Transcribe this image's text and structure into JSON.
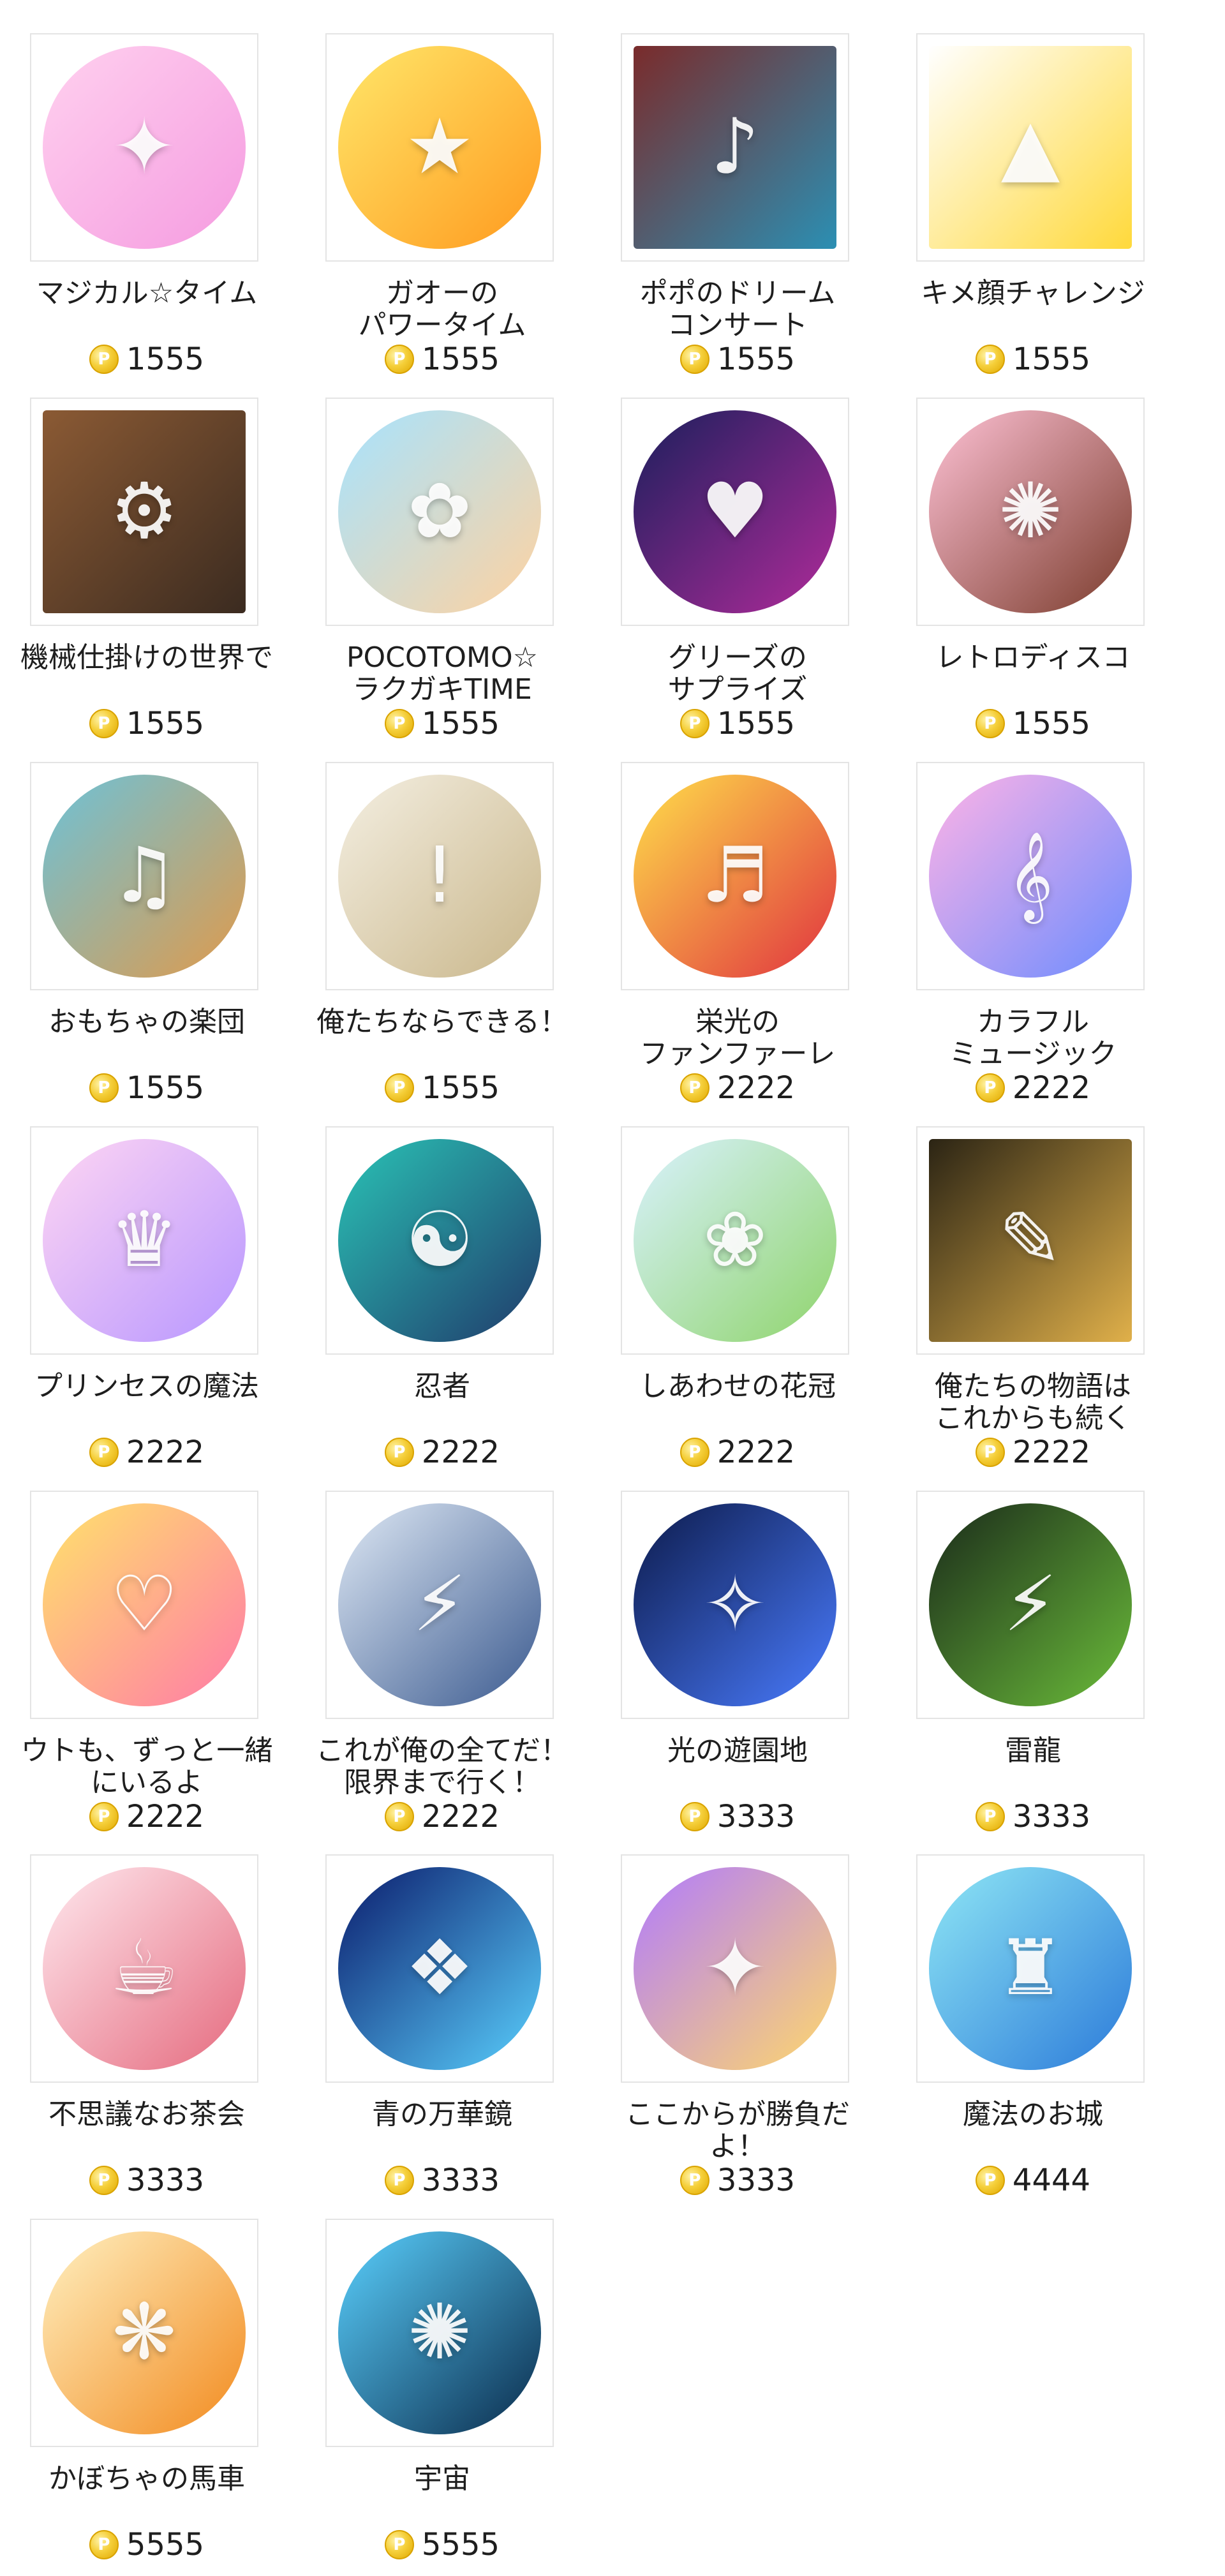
{
  "currency_symbol": "P",
  "stamps": [
    {
      "name": "マジカル☆タイム",
      "price": "1555",
      "glyph": "✦",
      "colors": [
        "#ffd1ef",
        "#f59be0"
      ],
      "icon": "magic-girl-icon"
    },
    {
      "name": "ガオーの\nパワータイム",
      "price": "1555",
      "glyph": "★",
      "colors": [
        "#ffe76a",
        "#ff9a1e"
      ],
      "icon": "hero-bear-icon"
    },
    {
      "name": "ポポのドリーム\nコンサート",
      "price": "1555",
      "glyph": "♪",
      "colors": [
        "#7a2b2b",
        "#2b8fb3"
      ],
      "icon": "concert-icon"
    },
    {
      "name": "キメ顔チャレンジ",
      "price": "1555",
      "glyph": "▲",
      "colors": [
        "#ffffff",
        "#ffd93b"
      ],
      "icon": "ready-go-icon"
    },
    {
      "name": "機械仕掛けの世界で",
      "price": "1555",
      "glyph": "⚙",
      "colors": [
        "#8b5a34",
        "#3b2b20"
      ],
      "icon": "gears-icon"
    },
    {
      "name": "POCOTOMO☆\nラクガキTIME",
      "price": "1555",
      "glyph": "✿",
      "colors": [
        "#a7e3ff",
        "#ffd2a0"
      ],
      "icon": "doodle-train-icon"
    },
    {
      "name": "グリーズの\nサプライズ",
      "price": "1555",
      "glyph": "♥",
      "colors": [
        "#1b1f5c",
        "#b02b9a"
      ],
      "icon": "bear-heart-icon"
    },
    {
      "name": "レトロディスコ",
      "price": "1555",
      "glyph": "✺",
      "colors": [
        "#ffc2d6",
        "#7a3b2b"
      ],
      "icon": "disco-afro-icon"
    },
    {
      "name": "おもちゃの楽団",
      "price": "1555",
      "glyph": "♫",
      "colors": [
        "#6cc2d9",
        "#e09a4b"
      ],
      "icon": "toy-band-icon"
    },
    {
      "name": "俺たちならできる！",
      "price": "1555",
      "glyph": "!",
      "colors": [
        "#f4efe2",
        "#c9b68a"
      ],
      "icon": "we-can-do-it-icon"
    },
    {
      "name": "栄光の\nファンファーレ",
      "price": "2222",
      "glyph": "♬",
      "colors": [
        "#ffe04a",
        "#e0323f"
      ],
      "icon": "trumpet-icon"
    },
    {
      "name": "カラフル\nミュージック",
      "price": "2222",
      "glyph": "𝄞",
      "colors": [
        "#ffb3e6",
        "#6b8cff"
      ],
      "icon": "treble-clef-icon"
    },
    {
      "name": "プリンセスの魔法",
      "price": "2222",
      "glyph": "♛",
      "colors": [
        "#ffd6f3",
        "#b796ff"
      ],
      "icon": "princess-icon"
    },
    {
      "name": "忍者",
      "price": "2222",
      "glyph": "☯",
      "colors": [
        "#2ac4b6",
        "#203a6b"
      ],
      "icon": "ninja-icon"
    },
    {
      "name": "しあわせの花冠",
      "price": "2222",
      "glyph": "❀",
      "colors": [
        "#d9f2ff",
        "#8fd46b"
      ],
      "icon": "flower-crown-icon"
    },
    {
      "name": "俺たちの物語は\nこれからも続く",
      "price": "2222",
      "glyph": "✎",
      "colors": [
        "#2b2414",
        "#e0b04a"
      ],
      "icon": "to-be-continued-icon"
    },
    {
      "name": "ウトも、ずっと一緒\nにいるよ",
      "price": "2222",
      "glyph": "♡",
      "colors": [
        "#ffe36b",
        "#ff7aa8"
      ],
      "icon": "together-icon"
    },
    {
      "name": "これが俺の全てだ！\n限界まで行く！",
      "price": "2222",
      "glyph": "⚡",
      "colors": [
        "#dfe9f5",
        "#3b5a8f"
      ],
      "icon": "limit-break-icon"
    },
    {
      "name": "光の遊園地",
      "price": "3333",
      "glyph": "✧",
      "colors": [
        "#0c1a4a",
        "#4a7cff"
      ],
      "icon": "amusement-park-icon"
    },
    {
      "name": "雷龍",
      "price": "3333",
      "glyph": "⚡",
      "colors": [
        "#1a2a1a",
        "#6bbd3a"
      ],
      "icon": "thunder-dragon-icon"
    },
    {
      "name": "不思議なお茶会",
      "price": "3333",
      "glyph": "☕",
      "colors": [
        "#ffe9ef",
        "#e56a7e"
      ],
      "icon": "tea-party-icon"
    },
    {
      "name": "青の万華鏡",
      "price": "3333",
      "glyph": "❖",
      "colors": [
        "#0a1a6b",
        "#5ad1ff"
      ],
      "icon": "kaleidoscope-icon"
    },
    {
      "name": "ここからが勝負だ\nよ！",
      "price": "3333",
      "glyph": "✦",
      "colors": [
        "#b07aff",
        "#ffd86b"
      ],
      "icon": "showdown-icon"
    },
    {
      "name": "魔法のお城",
      "price": "4444",
      "glyph": "♜",
      "colors": [
        "#8fe7f5",
        "#2b7ad9"
      ],
      "icon": "castle-icon"
    },
    {
      "name": "かぼちゃの馬車",
      "price": "5555",
      "glyph": "❋",
      "colors": [
        "#fff1c2",
        "#f28a1e"
      ],
      "icon": "pumpkin-carriage-icon"
    },
    {
      "name": "宇宙",
      "price": "5555",
      "glyph": "✺",
      "colors": [
        "#5ad1ff",
        "#0a2a4a"
      ],
      "icon": "space-ship-icon"
    }
  ]
}
